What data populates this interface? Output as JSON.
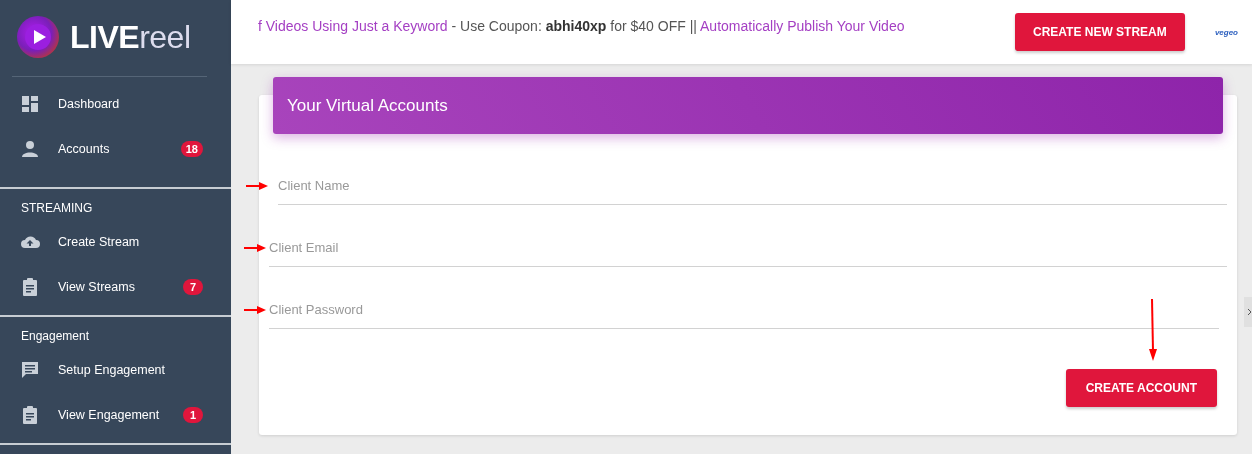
{
  "logo": {
    "bold": "LIVE",
    "light": "reel"
  },
  "sidebar": {
    "sections": [
      {
        "items": [
          {
            "label": "Dashboard",
            "kind": "dashboard"
          },
          {
            "label": "Accounts",
            "kind": "person",
            "badge": "18"
          }
        ]
      },
      {
        "header": "STREAMING",
        "items": [
          {
            "label": "Create Stream",
            "kind": "cloud"
          },
          {
            "label": "View Streams",
            "kind": "clipboard",
            "badge": "7"
          }
        ]
      },
      {
        "header": "Engagement",
        "items": [
          {
            "label": "Setup Engagement",
            "kind": "chat"
          },
          {
            "label": "View Engagement",
            "kind": "clipboard",
            "badge": "1"
          }
        ]
      }
    ]
  },
  "topbar": {
    "marquee": [
      {
        "text": "f Videos Using Just a Keyword",
        "kind": "link"
      },
      {
        "text": " - Use Coupon: ",
        "kind": "plain"
      },
      {
        "text": "abhi40xp",
        "kind": "bold"
      },
      {
        "text": " for $40 OFF || ",
        "kind": "plain"
      },
      {
        "text": "Automatically Publish Your Video",
        "kind": "link"
      }
    ],
    "button": "CREATE NEW STREAM",
    "brand": "vegeo"
  },
  "card": {
    "title": "Your Virtual Accounts",
    "fields": [
      {
        "placeholder": "Client Name"
      },
      {
        "placeholder": "Client Email"
      },
      {
        "placeholder": "Client Password"
      }
    ],
    "button": "CREATE ACCOUNT"
  }
}
